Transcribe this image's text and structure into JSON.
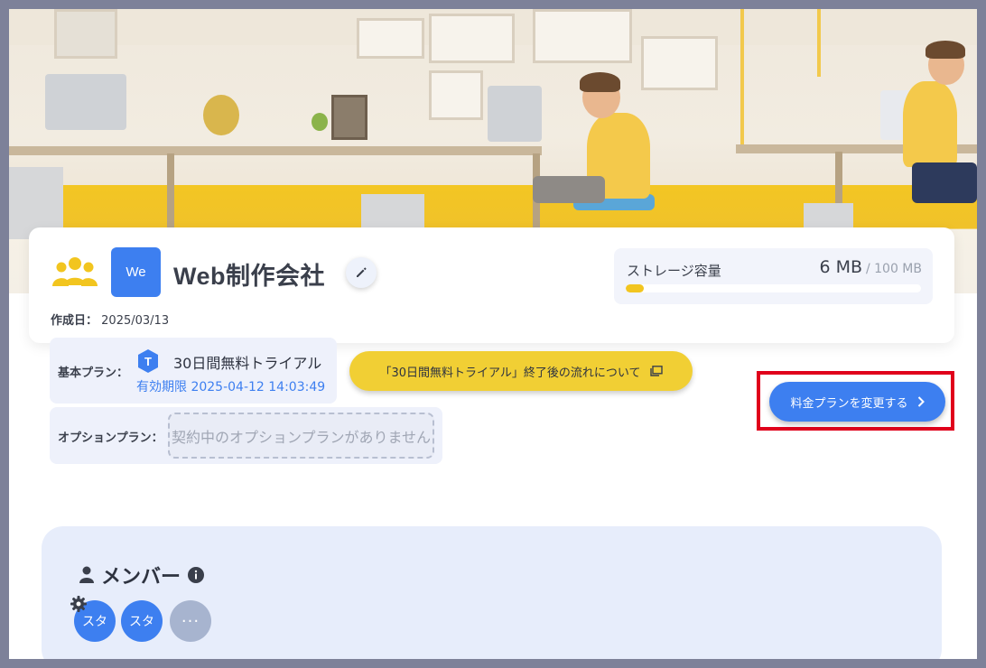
{
  "company": {
    "avatar_text": "We",
    "name": "Web制作会社",
    "created_label": "作成日：",
    "created_date": "2025/03/13"
  },
  "storage": {
    "label": "ストレージ容量",
    "used": "6 MB",
    "total": "/ 100 MB",
    "used_fraction": 0.06
  },
  "plan": {
    "label": "基本プラン：",
    "badge": "T",
    "name": "30日間無料トライアル",
    "expiry": "有効期限 2025-04-12 14:03:49",
    "flow_button": "「30日間無料トライアル」終了後の流れについて"
  },
  "option_plan": {
    "label": "オプションプラン：",
    "empty_text": "契約中のオプションプランがありません"
  },
  "change_plan_button": "料金プランを変更する",
  "members": {
    "title": "メンバー",
    "items": [
      "スタ",
      "スタ"
    ],
    "more": "···"
  },
  "colors": {
    "primary": "#3d7ff0",
    "accent_yellow": "#f1cf34",
    "highlight_red": "#e0001b"
  }
}
